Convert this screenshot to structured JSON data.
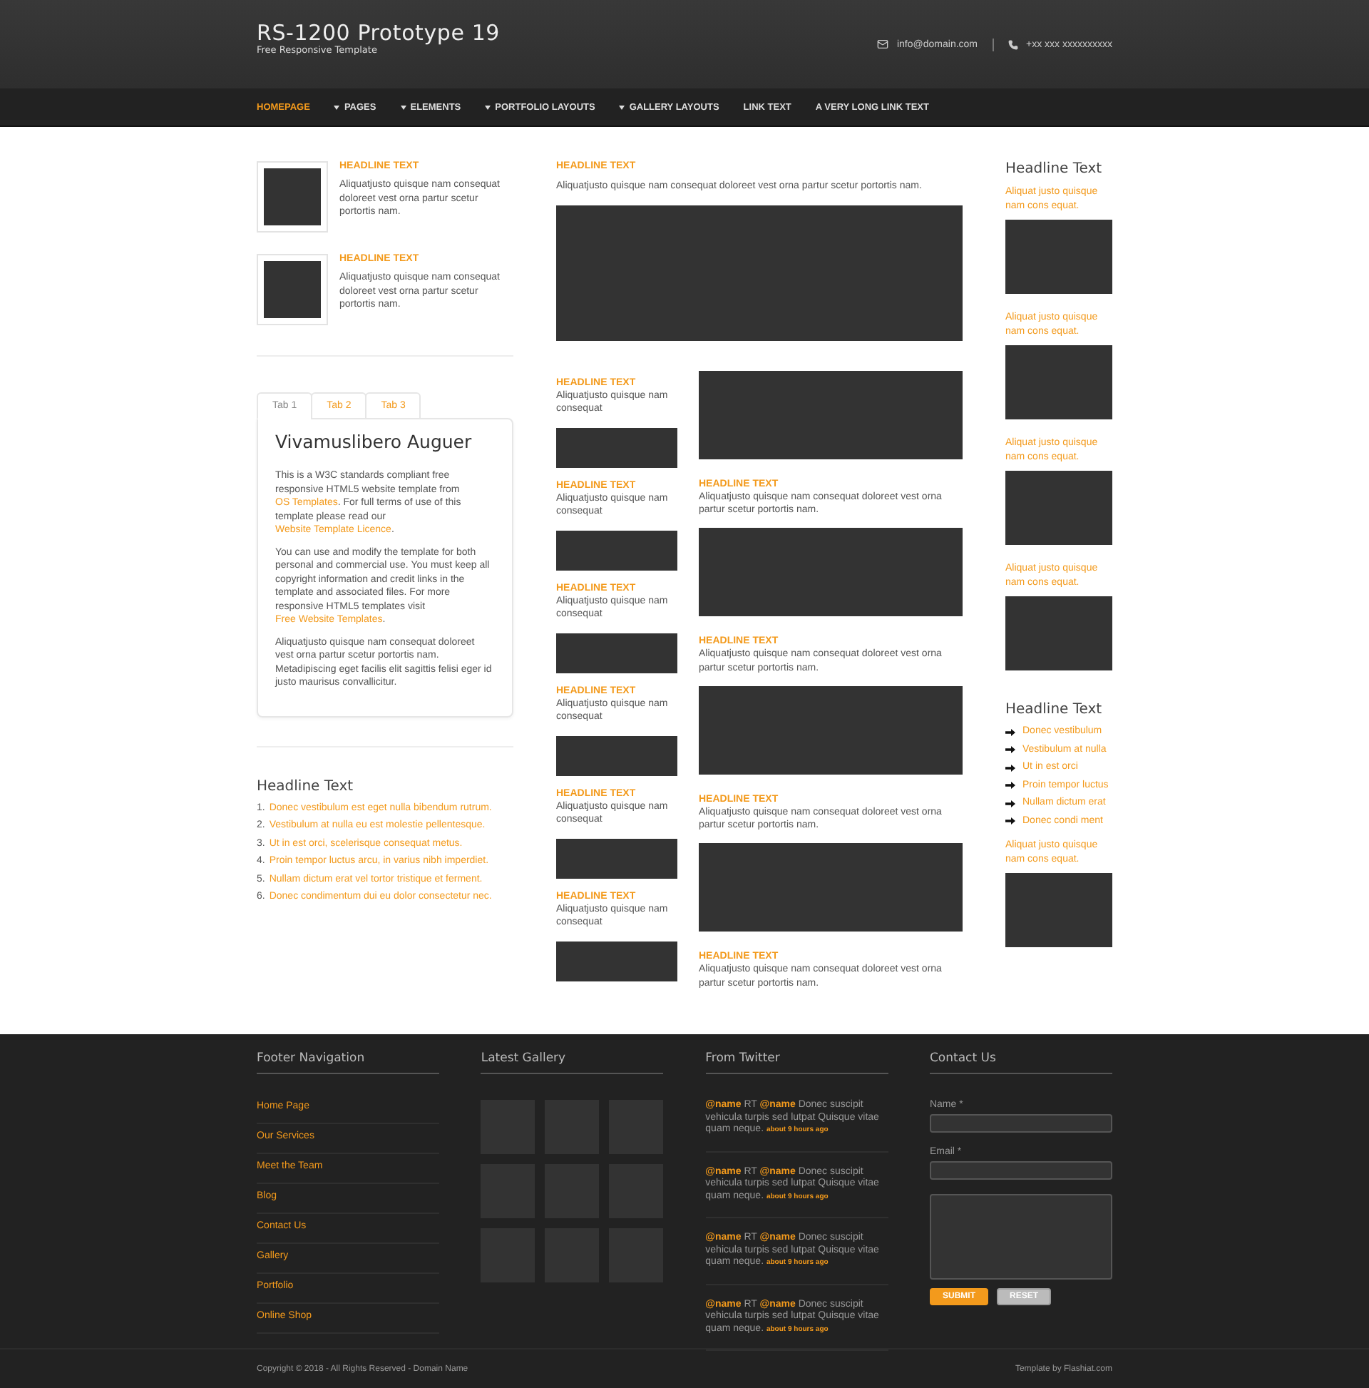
{
  "header": {
    "title": "RS-1200 Prototype 19",
    "tagline": "Free Responsive Template",
    "email": "info@domain.com",
    "phone": "+xx xxx xxxxxxxxxx"
  },
  "nav": [
    {
      "label": "HOMEPAGE",
      "dropdown": false,
      "selected": true
    },
    {
      "label": "PAGES",
      "dropdown": true,
      "selected": false
    },
    {
      "label": "ELEMENTS",
      "dropdown": true,
      "selected": false
    },
    {
      "label": "PORTFOLIO LAYOUTS",
      "dropdown": true,
      "selected": false
    },
    {
      "label": "GALLERY LAYOUTS",
      "dropdown": true,
      "selected": false
    },
    {
      "label": "LINK TEXT",
      "dropdown": false,
      "selected": false
    },
    {
      "label": "A VERY LONG LINK TEXT",
      "dropdown": false,
      "selected": false
    }
  ],
  "left": {
    "features": [
      {
        "headline": "HEADLINE TEXT",
        "text": "Aliquatjusto quisque nam consequat doloreet vest orna partur scetur portortis nam."
      },
      {
        "headline": "HEADLINE TEXT",
        "text": "Aliquatjusto quisque nam consequat doloreet vest orna partur scetur portortis nam."
      }
    ],
    "tabs": [
      {
        "label": "Tab 1",
        "selected": true
      },
      {
        "label": "Tab 2",
        "selected": false
      },
      {
        "label": "Tab 3",
        "selected": false
      }
    ],
    "panel": {
      "title": "Vivamuslibero Auguer",
      "paragraphs": [
        [
          {
            "kind": "text",
            "text": "This is a W3C standards compliant free responsive HTML5 website template from "
          },
          {
            "kind": "link",
            "text": "OS Templates"
          },
          {
            "kind": "text",
            "text": ". For full terms of use of this template please read our "
          },
          {
            "kind": "link",
            "text": "Website Template Licence"
          },
          {
            "kind": "text",
            "text": "."
          }
        ],
        [
          {
            "kind": "text",
            "text": "You can use and modify the template for both personal and commercial use. You must keep all copyright information and credit links in the template and associated files. For more responsive HTML5 templates visit "
          },
          {
            "kind": "link",
            "text": "Free Website Templates"
          },
          {
            "kind": "text",
            "text": "."
          }
        ],
        [
          {
            "kind": "text",
            "text": "Aliquatjusto quisque nam consequat doloreet vest orna partur scetur portortis nam. Metadipiscing eget facilis elit sagittis felisi eger id justo maurisus convallicitur."
          }
        ]
      ]
    },
    "list": {
      "title": "Headline Text",
      "items": [
        {
          "number": "1.",
          "text": "Donec vestibulum est eget nulla bibendum rutrum."
        },
        {
          "number": "2.",
          "text": "Vestibulum at nulla eu est molestie pellentesque."
        },
        {
          "number": "3.",
          "text": "Ut in est orci, scelerisque consequat metus."
        },
        {
          "number": "4.",
          "text": "Proin tempor luctus arcu, in varius nibh imperdiet."
        },
        {
          "number": "5.",
          "text": "Nullam dictum erat vel tortor tristique et ferment."
        },
        {
          "number": "6.",
          "text": "Donec condimentum dui eu dolor consectetur nec."
        }
      ]
    }
  },
  "middle": {
    "lead": {
      "headline": "HEADLINE TEXT",
      "text": "Aliquatjusto quisque nam consequat doloreet vest orna partur scetur portortis nam."
    },
    "narrow_items": [
      {
        "headline": "HEADLINE TEXT",
        "text": "Aliquatjusto quisque nam consequat"
      },
      {
        "headline": "HEADLINE TEXT",
        "text": "Aliquatjusto quisque nam consequat"
      },
      {
        "headline": "HEADLINE TEXT",
        "text": "Aliquatjusto quisque nam consequat"
      },
      {
        "headline": "HEADLINE TEXT",
        "text": "Aliquatjusto quisque nam consequat"
      },
      {
        "headline": "HEADLINE TEXT",
        "text": "Aliquatjusto quisque nam consequat"
      },
      {
        "headline": "HEADLINE TEXT",
        "text": "Aliquatjusto quisque nam consequat"
      }
    ],
    "wide_items": [
      {
        "headline": "HEADLINE TEXT",
        "text": "Aliquatjusto quisque nam consequat doloreet vest orna partur scetur portortis nam."
      },
      {
        "headline": "HEADLINE TEXT",
        "text": "Aliquatjusto quisque nam consequat doloreet vest orna partur scetur portortis nam."
      },
      {
        "headline": "HEADLINE TEXT",
        "text": "Aliquatjusto quisque nam consequat doloreet vest orna partur scetur portortis nam."
      },
      {
        "headline": "HEADLINE TEXT",
        "text": "Aliquatjusto quisque nam consequat doloreet vest orna partur scetur portortis nam."
      }
    ]
  },
  "right": [
    {
      "kind": "heading",
      "text": "Headline Text"
    },
    {
      "kind": "caption-image",
      "text": "Aliquat justo quisque nam cons equat."
    },
    {
      "kind": "caption-image",
      "text": "Aliquat justo quisque nam cons equat."
    },
    {
      "kind": "caption-image",
      "text": "Aliquat justo quisque nam cons equat."
    },
    {
      "kind": "caption-image",
      "text": "Aliquat justo quisque nam cons equat."
    },
    {
      "kind": "heading",
      "text": "Headline Text"
    },
    {
      "kind": "arrow-list",
      "items": [
        "Donec vestibulum",
        "Vestibulum at nulla",
        "Ut in est orci",
        "Proin tempor luctus",
        "Nullam dictum erat",
        "Donec condi ment"
      ]
    },
    {
      "kind": "caption-image",
      "text": "Aliquat justo quisque nam cons equat."
    }
  ],
  "footer": {
    "nav": {
      "title": "Footer Navigation",
      "links": [
        "Home Page",
        "Our Services",
        "Meet the Team",
        "Blog",
        "Contact Us",
        "Gallery",
        "Portfolio",
        "Online Shop"
      ]
    },
    "gallery": {
      "title": "Latest Gallery"
    },
    "twitter": {
      "title": "From Twitter",
      "tweets": [
        {
          "parts": [
            {
              "kind": "mention",
              "text": "@name"
            },
            {
              "kind": "text",
              "text": " RT "
            },
            {
              "kind": "mention",
              "text": "@name"
            },
            {
              "kind": "text",
              "text": " Donec suscipit vehicula turpis sed lutpat Quisque vitae quam neque. "
            }
          ],
          "time": "about 9 hours ago"
        },
        {
          "parts": [
            {
              "kind": "mention",
              "text": "@name"
            },
            {
              "kind": "text",
              "text": " RT "
            },
            {
              "kind": "mention",
              "text": "@name"
            },
            {
              "kind": "text",
              "text": " Donec suscipit vehicula turpis sed lutpat Quisque vitae quam neque. "
            }
          ],
          "time": "about 9 hours ago"
        },
        {
          "parts": [
            {
              "kind": "mention",
              "text": "@name"
            },
            {
              "kind": "text",
              "text": " RT "
            },
            {
              "kind": "mention",
              "text": "@name"
            },
            {
              "kind": "text",
              "text": " Donec suscipit vehicula turpis sed lutpat Quisque vitae quam neque. "
            }
          ],
          "time": "about 9 hours ago"
        },
        {
          "parts": [
            {
              "kind": "mention",
              "text": "@name"
            },
            {
              "kind": "text",
              "text": " RT "
            },
            {
              "kind": "mention",
              "text": "@name"
            },
            {
              "kind": "text",
              "text": " Donec suscipit vehicula turpis sed lutpat Quisque vitae quam neque. "
            }
          ],
          "time": "about 9 hours ago"
        }
      ]
    },
    "contact": {
      "title": "Contact Us",
      "name_label": "Name *",
      "email_label": "Email *",
      "submit": "SUBMIT",
      "reset": "RESET"
    },
    "copyright": "Copyright © 2018 - All Rights Reserved - Domain Name",
    "credit": "Template by Flashiat.com"
  }
}
